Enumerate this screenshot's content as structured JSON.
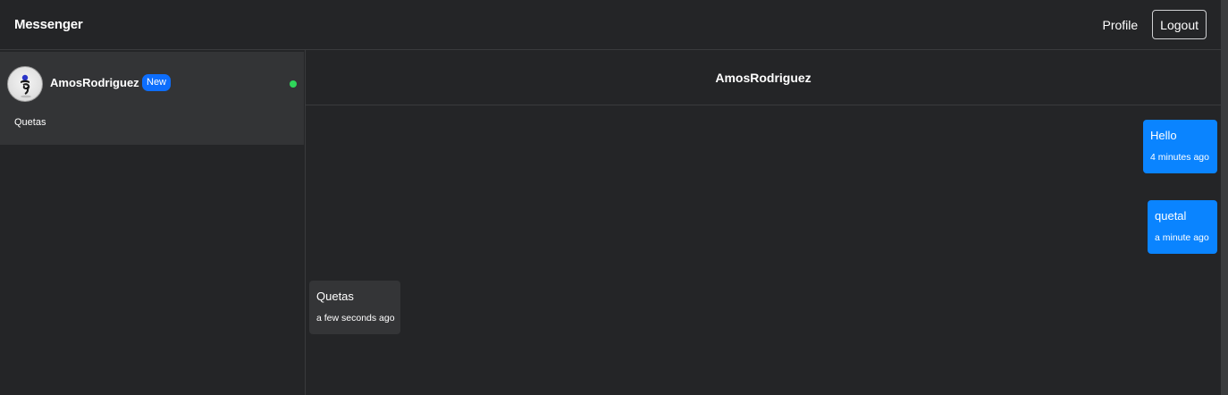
{
  "navbar": {
    "brand": "Messenger",
    "profile_label": "Profile",
    "logout_label": "Logout"
  },
  "sidebar": {
    "conversations": [
      {
        "name": "AmosRodriguez",
        "badge": "New",
        "online": true,
        "preview": "Quetas",
        "avatar_icon": "user-avatar-icon"
      }
    ]
  },
  "chat": {
    "title": "AmosRodriguez",
    "messages": [
      {
        "direction": "sent",
        "text": "Hello",
        "time": "4 minutes ago"
      },
      {
        "direction": "sent",
        "text": "quetal",
        "time": "a minute ago"
      },
      {
        "direction": "received",
        "text": "Quetas",
        "time": "a few seconds ago"
      }
    ]
  },
  "colors": {
    "background": "#242527",
    "selected_conversation": "#333436",
    "sent_bubble": "#0a84ff",
    "received_bubble": "#343537",
    "badge": "#0d6efd",
    "online": "#2fd65a",
    "divider": "#3a3b3d"
  }
}
